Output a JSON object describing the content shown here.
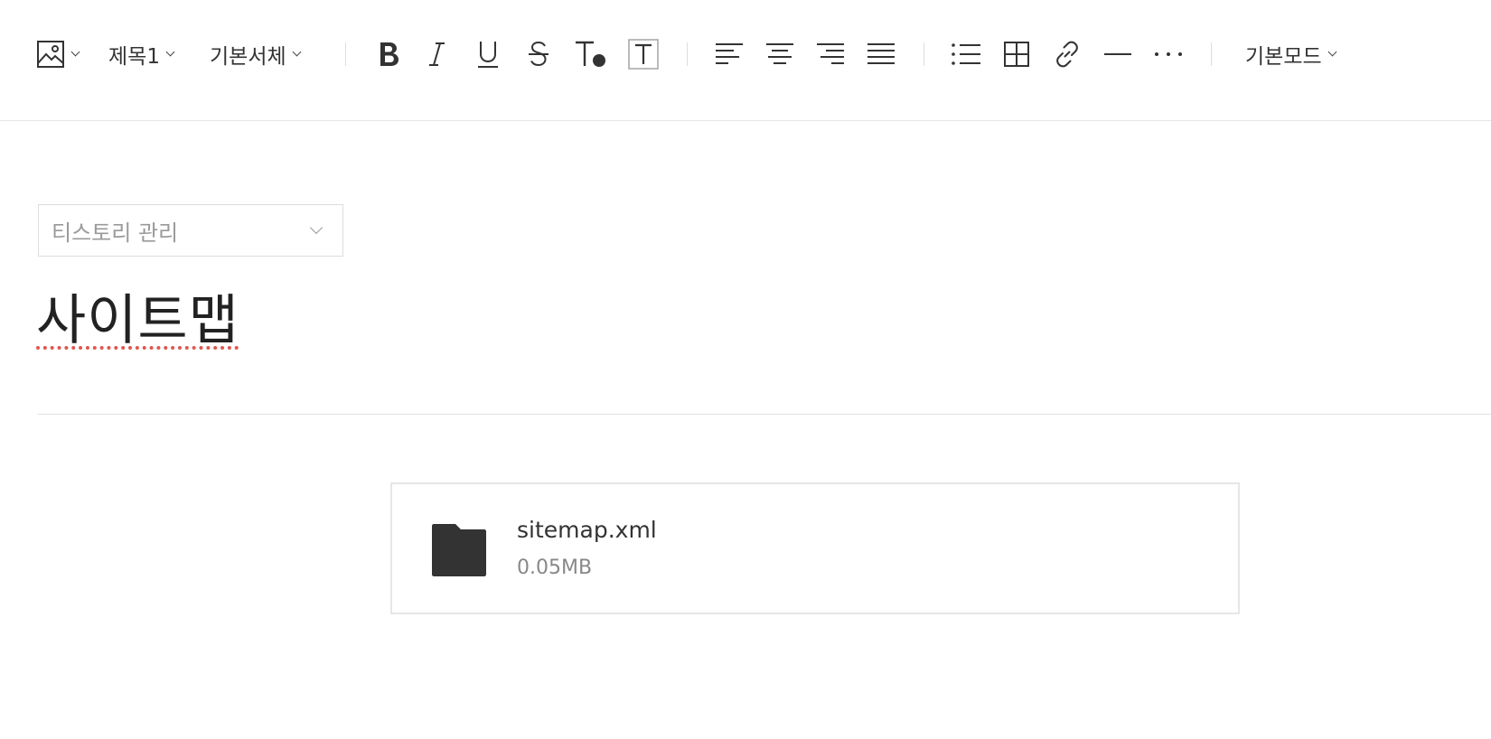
{
  "toolbar": {
    "heading_label": "제목1",
    "font_label": "기본서체",
    "mode_label": "기본모드",
    "icons": [
      "image-icon",
      "bold-icon",
      "italic-icon",
      "underline-icon",
      "strikethrough-icon",
      "text-color-icon",
      "text-background-icon",
      "align-left-icon",
      "align-center-icon",
      "align-right-icon",
      "align-justify-icon",
      "bulleted-list-icon",
      "table-icon",
      "link-icon",
      "horizontal-rule-icon",
      "more-icon"
    ]
  },
  "category": {
    "label": "티스토리 관리"
  },
  "post": {
    "title": "사이트맵"
  },
  "attachment": {
    "name": "sitemap.xml",
    "size": "0.05MB",
    "icon": "folder-icon"
  },
  "colors": {
    "text": "#333333",
    "spellcheck_underline": "#e0574f",
    "border": "#dddddd"
  }
}
